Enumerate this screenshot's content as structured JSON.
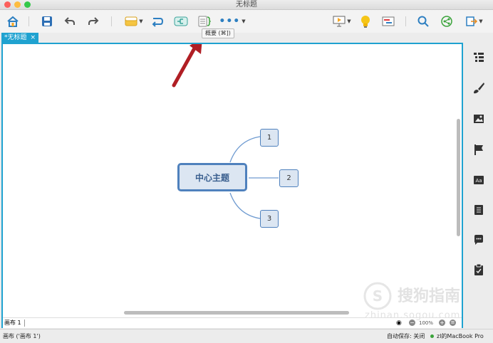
{
  "window": {
    "title": "无标题"
  },
  "toolbar": {
    "tooltip": "概要 (⌘])"
  },
  "tab": {
    "label": "*无标题",
    "close": "×"
  },
  "mindmap": {
    "central": "中心主题",
    "topics": [
      "1",
      "2",
      "3"
    ]
  },
  "sheet": {
    "name": "画布 1",
    "zoom": "100%"
  },
  "status": {
    "left": "画布 ('画布 1')",
    "autosave": "自动保存: 关闭",
    "user": "zl的MacBook Pro"
  },
  "watermark": {
    "text": "搜狗指南",
    "url": "zhinan.sogou.com"
  },
  "colors": {
    "accent": "#1fa2d0",
    "topic_fill": "#dce6f2",
    "topic_border": "#4f81bd",
    "arrow": "#b01e24"
  }
}
